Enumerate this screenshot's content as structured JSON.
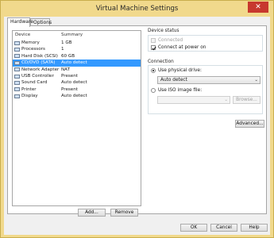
{
  "window": {
    "title": "Virtual Machine Settings",
    "close_glyph": "✕"
  },
  "tabs": [
    {
      "label": "Hardware",
      "active": true
    },
    {
      "label": "Options",
      "active": false
    }
  ],
  "devices": {
    "col_device": "Device",
    "col_summary": "Summary",
    "rows": [
      {
        "name": "Memory",
        "summary": "1 GB",
        "icon": "memory-icon",
        "selected": false
      },
      {
        "name": "Processors",
        "summary": "1",
        "icon": "processor-icon",
        "selected": false
      },
      {
        "name": "Hard Disk (SCSI)",
        "summary": "60 GB",
        "icon": "hard-disk-icon",
        "selected": false
      },
      {
        "name": "CD/DVD (SATA)",
        "summary": "Auto detect",
        "icon": "cd-dvd-icon",
        "selected": true
      },
      {
        "name": "Network Adapter",
        "summary": "NAT",
        "icon": "network-adapter-icon",
        "selected": false
      },
      {
        "name": "USB Controller",
        "summary": "Present",
        "icon": "usb-icon",
        "selected": false
      },
      {
        "name": "Sound Card",
        "summary": "Auto detect",
        "icon": "sound-card-icon",
        "selected": false
      },
      {
        "name": "Printer",
        "summary": "Present",
        "icon": "printer-icon",
        "selected": false
      },
      {
        "name": "Display",
        "summary": "Auto detect",
        "icon": "display-icon",
        "selected": false
      }
    ],
    "add_label": "Add...",
    "remove_label": "Remove"
  },
  "device_status": {
    "title": "Device status",
    "connected_label": "Connected",
    "connected_checked": false,
    "connect_at_power_on_label": "Connect at power on",
    "connect_at_power_on_checked": true
  },
  "connection": {
    "title": "Connection",
    "physical_label": "Use physical drive:",
    "physical_selected": true,
    "physical_value": "Auto detect",
    "iso_label": "Use ISO image file:",
    "iso_selected": false,
    "iso_value": "",
    "browse_label": "Browse...",
    "advanced_label": "Advanced..."
  },
  "footer": {
    "ok_label": "OK",
    "cancel_label": "Cancel",
    "help_label": "Help"
  },
  "colors": {
    "title_bar": "#f1d98c",
    "selection": "#3399ff",
    "close": "#c7382e"
  }
}
